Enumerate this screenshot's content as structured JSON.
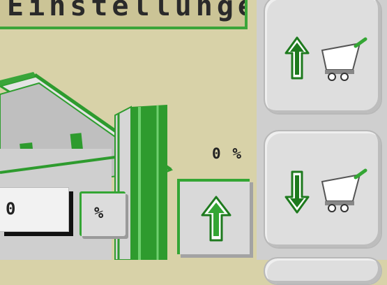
{
  "title": {
    "text": "Einstellungen"
  },
  "value_field": {
    "value": "0"
  },
  "unit_button": {
    "label": "%"
  },
  "readout": {
    "value": "0",
    "unit": "%"
  },
  "buttons": {
    "raise_label": "raise",
    "cart_up_label": "cart up",
    "cart_down_label": "cart down"
  },
  "icons": {
    "raise": "arrow-up-icon",
    "cart_up": "cart-up-icon",
    "cart_down": "cart-down-icon",
    "cart": "cart-icon"
  },
  "colors": {
    "accent_green": "#34a634",
    "dark_green": "#1e7a1e",
    "background": "#d8d2a8",
    "panel": "#cfcfcf"
  }
}
